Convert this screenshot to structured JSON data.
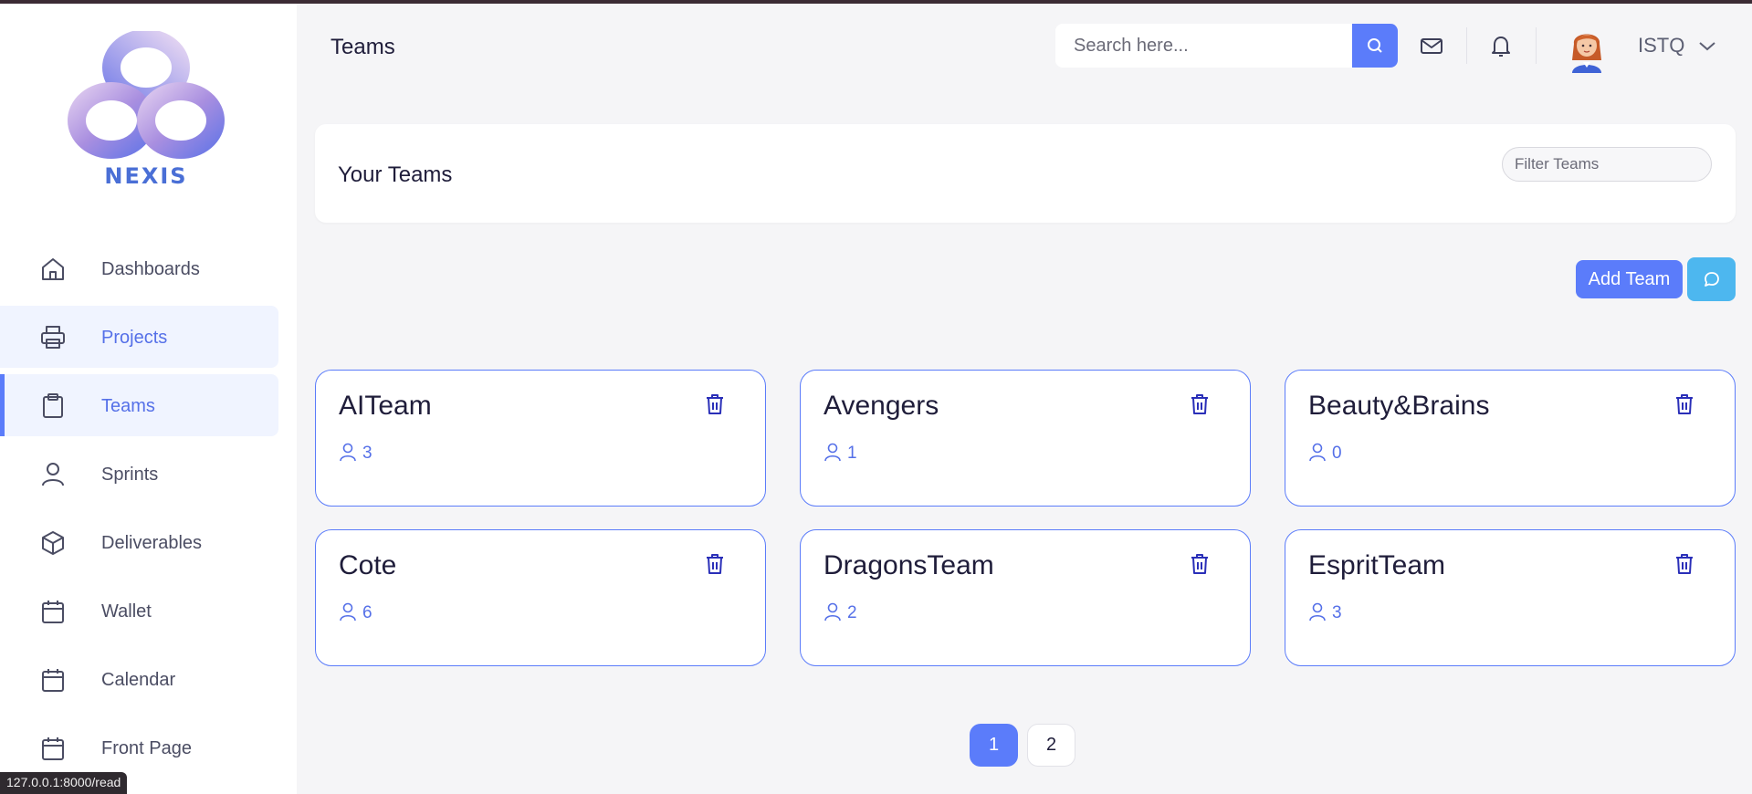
{
  "logo": {
    "text": "NEXIS"
  },
  "sidebar": {
    "items": [
      {
        "label": "Dashboards",
        "icon": "home-icon"
      },
      {
        "label": "Projects",
        "icon": "printer-icon"
      },
      {
        "label": "Teams",
        "icon": "clipboard-icon"
      },
      {
        "label": "Sprints",
        "icon": "user-icon"
      },
      {
        "label": "Deliverables",
        "icon": "box-icon"
      },
      {
        "label": "Wallet",
        "icon": "calendar-icon"
      },
      {
        "label": "Calendar",
        "icon": "calendar-icon"
      },
      {
        "label": "Front Page",
        "icon": "calendar-icon"
      }
    ]
  },
  "status_bar": {
    "url": "127.0.0.1:8000/read"
  },
  "header": {
    "title": "Teams",
    "search_placeholder": "Search here...",
    "user_name": "ISTQ"
  },
  "panel": {
    "title": "Your Teams",
    "filter_placeholder": "Filter Teams"
  },
  "actions": {
    "add_team_label": "Add Team"
  },
  "teams": [
    {
      "name": "AITeam",
      "members": "3"
    },
    {
      "name": "Avengers",
      "members": "1"
    },
    {
      "name": "Beauty&Brains",
      "members": "0"
    },
    {
      "name": "Cote",
      "members": "6"
    },
    {
      "name": "DragonsTeam",
      "members": "2"
    },
    {
      "name": "EspritTeam",
      "members": "3"
    }
  ],
  "pagination": {
    "pages": [
      "1",
      "2"
    ],
    "current": "1"
  },
  "colors": {
    "accent": "#5b7cfa",
    "chat": "#4db7ef",
    "sidebar_bg": "#ffffff",
    "page_bg": "#f5f5f7"
  }
}
